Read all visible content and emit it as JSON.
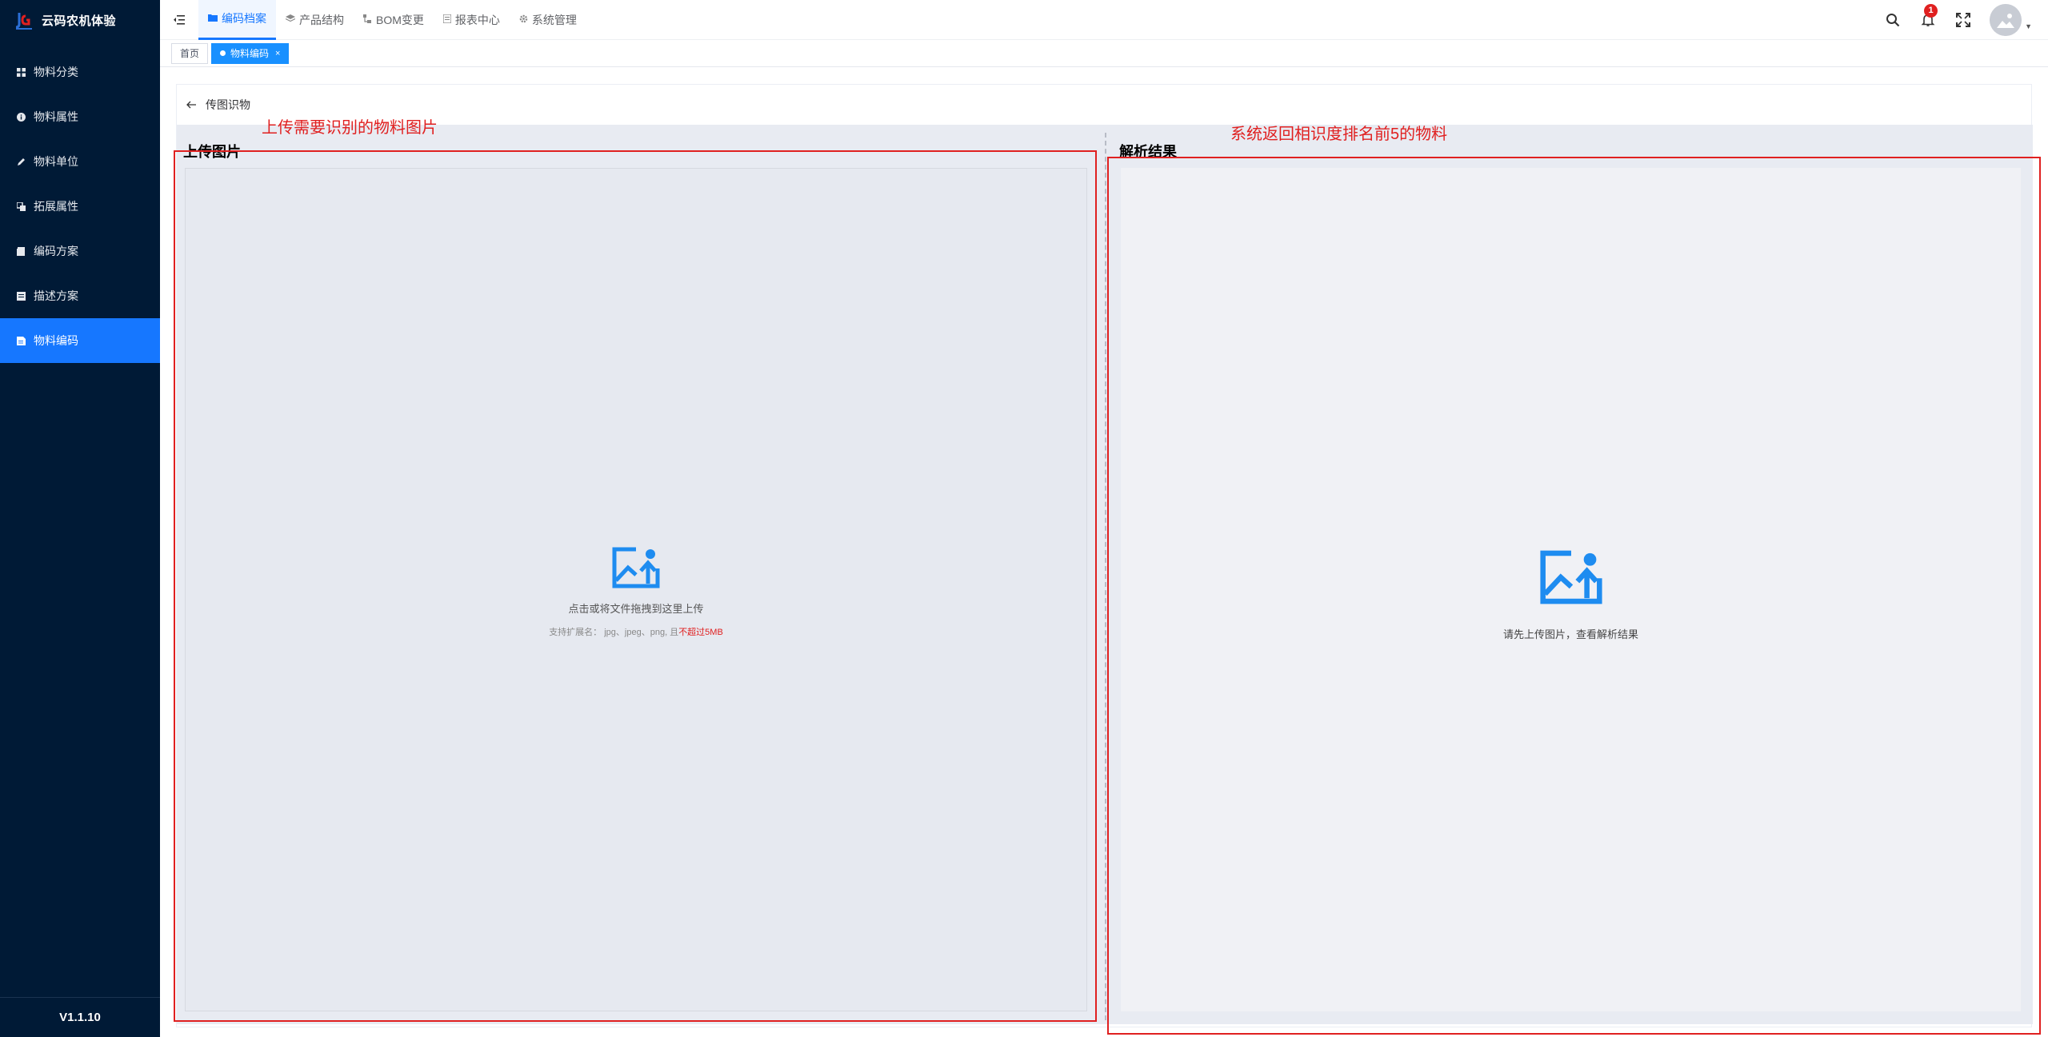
{
  "app": {
    "title": "云码农机体验",
    "version": "V1.1.10"
  },
  "sidebar": {
    "items": [
      {
        "label": "物料分类",
        "icon": "grid-icon",
        "active": false
      },
      {
        "label": "物料属性",
        "icon": "info-icon",
        "active": false
      },
      {
        "label": "物料单位",
        "icon": "pencil-icon",
        "active": false
      },
      {
        "label": "拓展属性",
        "icon": "layers-icon",
        "active": false
      },
      {
        "label": "编码方案",
        "icon": "document-icon",
        "active": false
      },
      {
        "label": "描述方案",
        "icon": "notes-icon",
        "active": false
      },
      {
        "label": "物料编码",
        "icon": "file-code-icon",
        "active": true
      }
    ]
  },
  "topnav": {
    "items": [
      {
        "label": "编码档案",
        "icon": "folder-icon",
        "active": true
      },
      {
        "label": "产品结构",
        "icon": "layers-icon",
        "active": false
      },
      {
        "label": "BOM变更",
        "icon": "hierarchy-icon",
        "active": false
      },
      {
        "label": "报表中心",
        "icon": "report-icon",
        "active": false
      },
      {
        "label": "系统管理",
        "icon": "gear-icon",
        "active": false
      }
    ],
    "notification_count": "1"
  },
  "tabs": [
    {
      "label": "首页",
      "active": false
    },
    {
      "label": "物料编码",
      "active": true,
      "close": "×"
    }
  ],
  "page": {
    "back_title": "传图识物",
    "upload_title": "上传图片",
    "result_title": "解析结果",
    "upload_hint": "点击或将文件拖拽到这里上传",
    "upload_tip_prefix": "支持扩展名： jpg、jpeg、png, 且",
    "upload_tip_warn": "不超过5MB",
    "result_hint": "请先上传图片，查看解析结果"
  },
  "annotations": {
    "upload_note": "上传需要识别的物料图片",
    "result_note": "系统返回相识度排名前5的物料"
  },
  "colors": {
    "sidebar_bg": "#001a36",
    "accent": "#1677ff",
    "annotation": "#e02020",
    "upload_icon": "#1e8cf0"
  }
}
